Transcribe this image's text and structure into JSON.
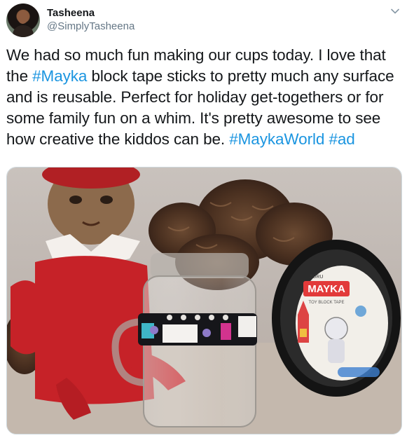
{
  "tweet": {
    "author_name": "Tasheena",
    "author_handle": "@SimplyTasheena",
    "text_parts": [
      {
        "text": "We had so much fun making our cups today. I love that the ",
        "tag": false
      },
      {
        "text": "#Mayka",
        "tag": true
      },
      {
        "text": " block tape sticks to pretty much any surface and is reusable. Perfect for holiday get-togethers or for some family fun on a whim. It's pretty awesome to see how creative the kiddos can be. ",
        "tag": false
      },
      {
        "text": "#MaykaWorld",
        "tag": true
      },
      {
        "text": " ",
        "tag": false
      },
      {
        "text": "#ad",
        "tag": true
      }
    ],
    "photo": {
      "product_logo": "MAYKA",
      "product_brand_small": "ZURU",
      "product_subtitle": "TOY BLOCK TAPE"
    }
  },
  "icons": {
    "menu": "chevron-down-icon"
  },
  "colors": {
    "hashtag": "#1b95e0",
    "handle": "#657786",
    "text": "#14171a"
  }
}
